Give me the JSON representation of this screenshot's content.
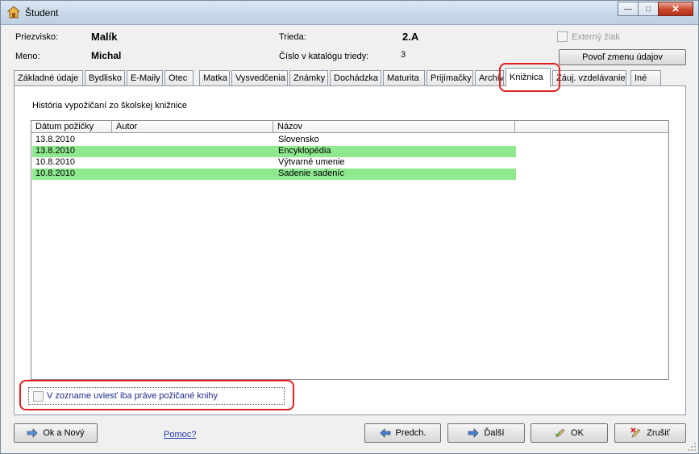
{
  "window": {
    "title": "Študent",
    "minimize": "—",
    "maximize": "□",
    "close": "✕"
  },
  "header": {
    "surname_label": "Priezvisko:",
    "surname_value": "Malík",
    "name_label": "Meno:",
    "name_value": "Michal",
    "class_label": "Trieda:",
    "class_value": "2.A",
    "catalog_label": "Číslo v katalógu triedy:",
    "catalog_value": "3",
    "external_label": "Externý žiak",
    "allow_edit_button": "Povoľ zmenu údajov"
  },
  "tabs": [
    {
      "label": "Základné údaje"
    },
    {
      "label": "Bydlisko"
    },
    {
      "label": "E-Maily"
    },
    {
      "label": "Otec"
    },
    {
      "label": "Matka"
    },
    {
      "label": "Vysvedčenia"
    },
    {
      "label": "Známky"
    },
    {
      "label": "Dochádzka"
    },
    {
      "label": "Maturita"
    },
    {
      "label": "Prijímačky"
    },
    {
      "label": "Archív"
    },
    {
      "label": "Knižnica"
    },
    {
      "label": "Záuj. vzdelávanie"
    },
    {
      "label": "Iné"
    }
  ],
  "library": {
    "history_title": "História vypožičaní zo školskej knižnice",
    "columns": [
      "Dátum požičky",
      "Autor",
      "Názov"
    ],
    "rows": [
      {
        "date": "13.8.2010",
        "author": "",
        "title": "Slovensko"
      },
      {
        "date": "13.8.2010",
        "author": "",
        "title": "Encyklopédia"
      },
      {
        "date": "10.8.2010",
        "author": "",
        "title": "Výtvarné umenie"
      },
      {
        "date": "10.8.2010",
        "author": "",
        "title": "Sadenie sadeníc"
      }
    ],
    "only_borrowed_label": "V zozname uviesť iba práve požičané knihy",
    "row_highlight_color": "#8ee88e"
  },
  "footer": {
    "ok_new": "Ok a Nový",
    "help": "Pomoc?",
    "prev": "Predch.",
    "next": "Ďalší",
    "ok": "OK",
    "cancel": "Zrušiť"
  },
  "colors": {
    "annotation_red": "#e02020"
  }
}
